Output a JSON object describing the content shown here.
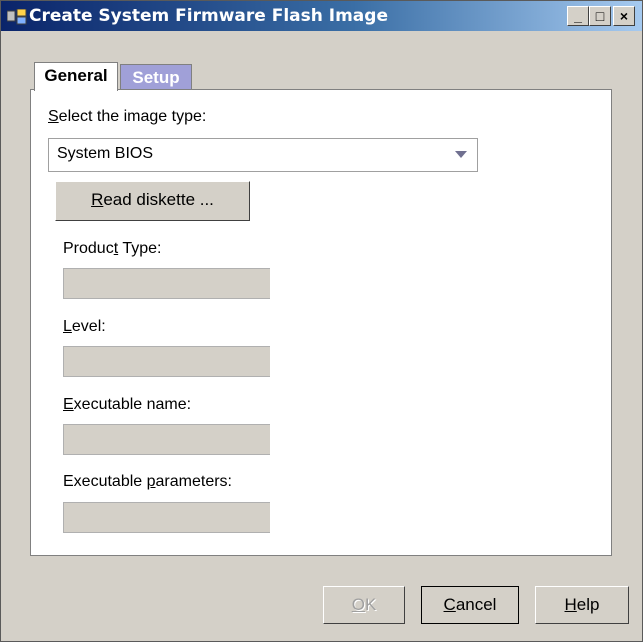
{
  "window": {
    "title": "Create System Firmware Flash Image",
    "controls": {
      "minimize": "_",
      "maximize": "□",
      "close": "×"
    }
  },
  "tabs": [
    {
      "label": "General",
      "active": true
    },
    {
      "label": "Setup",
      "active": false
    }
  ],
  "general": {
    "image_type_label": "Select the image type:",
    "image_type_value": "System BIOS",
    "read_diskette_label": "Read diskette ...",
    "fields": {
      "product_type": {
        "label": "Product Type:",
        "value": ""
      },
      "level": {
        "label": "Level:",
        "value": ""
      },
      "executable_name": {
        "label": "Executable name:",
        "value": ""
      },
      "executable_parameters": {
        "label": "Executable parameters:",
        "value": ""
      }
    }
  },
  "footer": {
    "ok_label": "OK",
    "cancel_label": "Cancel",
    "help_label": "Help"
  },
  "colors": {
    "title_gradient_start": "#0a246a",
    "title_gradient_end": "#a6caf0",
    "inactive_tab": "#a0a0d8",
    "dialog_bg": "#d4d0c8"
  }
}
